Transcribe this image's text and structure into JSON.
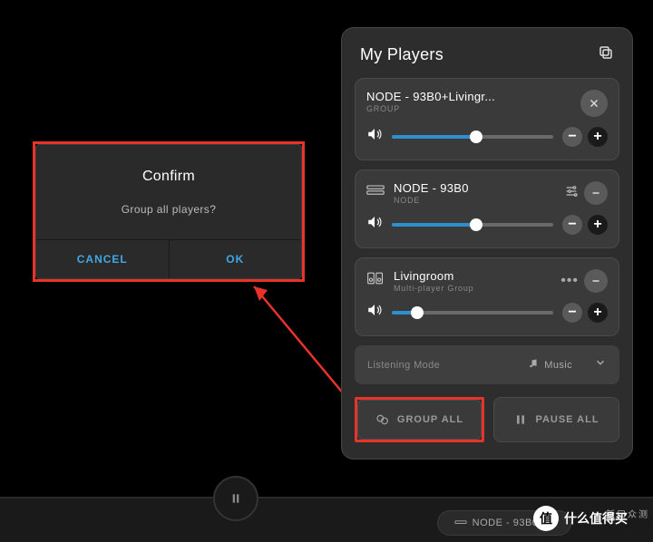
{
  "dialog": {
    "title": "Confirm",
    "message": "Group all players?",
    "cancel": "CANCEL",
    "ok": "OK"
  },
  "panel": {
    "title": "My Players",
    "players": [
      {
        "name": "NODE - 93B0+Livingr...",
        "sub": "GROUP",
        "vol_percent": 52
      },
      {
        "name": "NODE - 93B0",
        "sub": "NODE",
        "vol_percent": 52
      },
      {
        "name": "Livingroom",
        "sub": "Multi-player Group",
        "vol_percent": 16
      }
    ],
    "listening": {
      "label": "Listening Mode",
      "value": "Music"
    },
    "group_all": "GROUP ALL",
    "pause_all": "PAUSE ALL"
  },
  "bottombar": {
    "pill": "NODE - 93B0+..."
  },
  "watermark": {
    "char": "值",
    "text": "什么值得买",
    "sub": "新口众测"
  }
}
